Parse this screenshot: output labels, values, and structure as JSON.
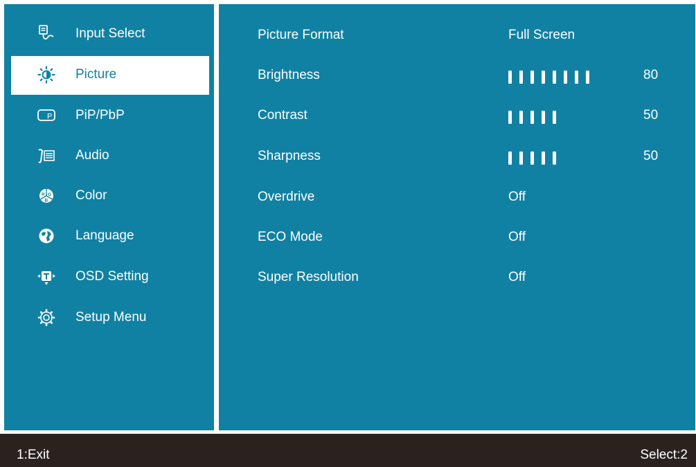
{
  "sidebar": {
    "items": [
      {
        "label": "Input Select",
        "icon": "input-select-icon"
      },
      {
        "label": "Picture",
        "icon": "brightness-sun-icon",
        "selected": true
      },
      {
        "label": "PiP/PbP",
        "icon": "pip-icon",
        "icon_text": "P"
      },
      {
        "label": "Audio",
        "icon": "audio-icon"
      },
      {
        "label": "Color",
        "icon": "color-rgb-icon",
        "icon_text": [
          "R",
          "G",
          "B"
        ]
      },
      {
        "label": "Language",
        "icon": "language-globe-icon"
      },
      {
        "label": "OSD Setting",
        "icon": "osd-setting-icon"
      },
      {
        "label": "Setup Menu",
        "icon": "gear-icon"
      }
    ]
  },
  "picture_settings": [
    {
      "name": "Picture Format",
      "value": "Full Screen"
    },
    {
      "name": "Brightness",
      "level": 80,
      "value": "80"
    },
    {
      "name": "Contrast",
      "level": 50,
      "value": "50"
    },
    {
      "name": "Sharpness",
      "level": 50,
      "value": "50"
    },
    {
      "name": "Overdrive",
      "value": "Off"
    },
    {
      "name": "ECO Mode",
      "value": "Off"
    },
    {
      "name": "Super Resolution",
      "value": "Off"
    }
  ],
  "footer": {
    "exit_hint": "1:Exit",
    "select_hint": "Select:2"
  },
  "colors": {
    "panel_blue": "#1181a3",
    "footer_dark": "#2b2220",
    "text": "#ffffff"
  }
}
